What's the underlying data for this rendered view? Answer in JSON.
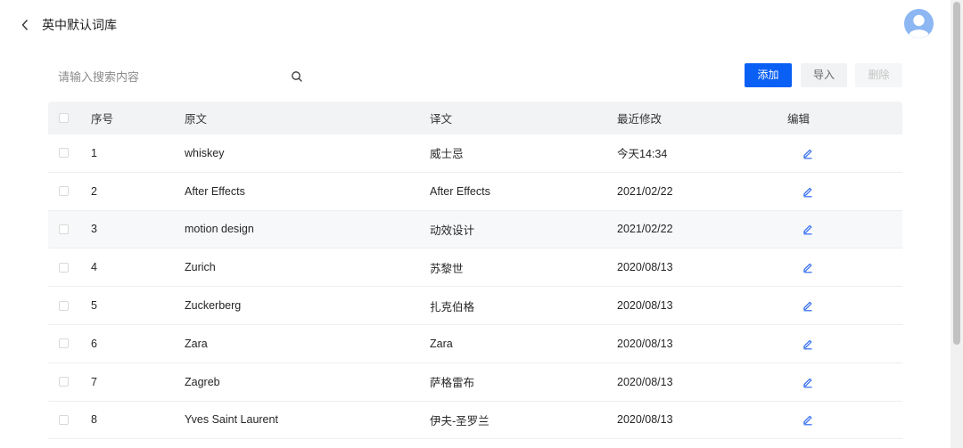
{
  "header": {
    "title": "英中默认词库"
  },
  "search": {
    "placeholder": "请输入搜索内容",
    "value": ""
  },
  "toolbar": {
    "add_label": "添加",
    "import_label": "导入",
    "delete_label": "删除"
  },
  "table": {
    "headers": {
      "index": "序号",
      "source": "原文",
      "translation": "译文",
      "modified": "最近修改",
      "edit": "编辑"
    },
    "rows": [
      {
        "index": "1",
        "source": "whiskey",
        "translation": "威士忌",
        "modified": "今天14:34"
      },
      {
        "index": "2",
        "source": "After Effects",
        "translation": "After Effects",
        "modified": "2021/02/22"
      },
      {
        "index": "3",
        "source": "motion design",
        "translation": "动效设计",
        "modified": "2021/02/22"
      },
      {
        "index": "4",
        "source": "Zurich",
        "translation": "苏黎世",
        "modified": "2020/08/13"
      },
      {
        "index": "5",
        "source": "Zuckerberg",
        "translation": "扎克伯格",
        "modified": "2020/08/13"
      },
      {
        "index": "6",
        "source": "Zara",
        "translation": "Zara",
        "modified": "2020/08/13"
      },
      {
        "index": "7",
        "source": "Zagreb",
        "translation": "萨格雷布",
        "modified": "2020/08/13"
      },
      {
        "index": "8",
        "source": "Yves Saint Laurent",
        "translation": "伊夫-圣罗兰",
        "modified": "2020/08/13"
      }
    ]
  },
  "colors": {
    "primary": "#0a5ff5",
    "edit_icon": "#2f6bf0",
    "header_bg": "#f2f3f5",
    "row_highlight": "#f7f8fa"
  },
  "icons": {
    "back": "chevron-left-icon",
    "search": "search-icon",
    "edit": "pencil-icon",
    "avatar": "user-avatar-icon"
  }
}
